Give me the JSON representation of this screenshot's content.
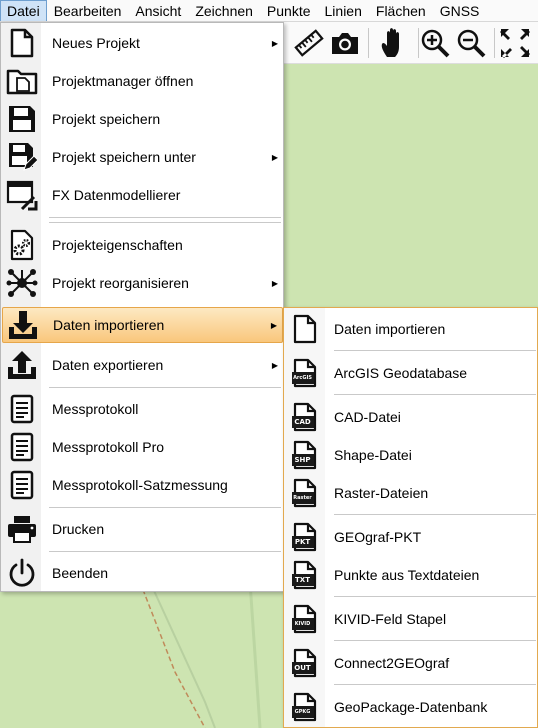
{
  "menubar": {
    "items": [
      "Datei",
      "Bearbeiten",
      "Ansicht",
      "Zeichnen",
      "Punkte",
      "Linien",
      "Flächen",
      "GNSS"
    ],
    "active_index": 0
  },
  "toolbar": {
    "icons": [
      "ruler-icon",
      "camera-icon",
      "hand-icon",
      "zoom-in-icon",
      "zoom-out-icon",
      "zoom-fit-icon"
    ]
  },
  "file_menu": {
    "items": [
      {
        "label": "Neues Projekt",
        "icon": "new-document-icon",
        "submenu": true
      },
      {
        "label": "Projektmanager öffnen",
        "icon": "project-manager-icon",
        "submenu": false
      },
      {
        "label": "Projekt speichern",
        "icon": "save-icon",
        "submenu": false
      },
      {
        "label": "Projekt speichern unter",
        "icon": "save-as-icon",
        "submenu": true
      },
      {
        "label": "FX Datenmodellierer",
        "icon": "data-modeler-icon",
        "submenu": false
      },
      {
        "label": "Projekteigenschaften",
        "icon": "project-properties-icon",
        "submenu": false
      },
      {
        "label": "Projekt reorganisieren",
        "icon": "reorganize-icon",
        "submenu": true
      },
      {
        "label": "Daten importieren",
        "icon": "import-icon",
        "submenu": true,
        "highlighted": true
      },
      {
        "label": "Daten exportieren",
        "icon": "export-icon",
        "submenu": true
      },
      {
        "label": "Messprotokoll",
        "icon": "protocol-icon",
        "submenu": false
      },
      {
        "label": "Messprotokoll Pro",
        "icon": "protocol-pro-icon",
        "submenu": false
      },
      {
        "label": "Messprotokoll-Satzmessung",
        "icon": "protocol-set-icon",
        "submenu": false
      },
      {
        "label": "Drucken",
        "icon": "printer-icon",
        "submenu": false
      },
      {
        "label": "Beenden",
        "icon": "power-icon",
        "submenu": false
      }
    ]
  },
  "import_submenu": {
    "items": [
      {
        "label": "Daten importieren",
        "tag": ""
      },
      {
        "label": "ArcGIS Geodatabase",
        "tag": "ArcGIS"
      },
      {
        "label": "CAD-Datei",
        "tag": "CAD"
      },
      {
        "label": "Shape-Datei",
        "tag": "SHP"
      },
      {
        "label": "Raster-Dateien",
        "tag": "Raster"
      },
      {
        "label": "GEOgraf-PKT",
        "tag": "PKT"
      },
      {
        "label": "Punkte aus Textdateien",
        "tag": "TXT"
      },
      {
        "label": "KIVID-Feld Stapel",
        "tag": "KIVID"
      },
      {
        "label": "Connect2GEOgraf",
        "tag": "OUT"
      },
      {
        "label": "GeoPackage-Datenbank",
        "tag": "GPKG"
      }
    ]
  },
  "colors": {
    "highlight_start": "#fde9c2",
    "highlight_end": "#f9c77c",
    "map_green": "#cde4b1",
    "menubar_active": "#cfe3f7"
  }
}
